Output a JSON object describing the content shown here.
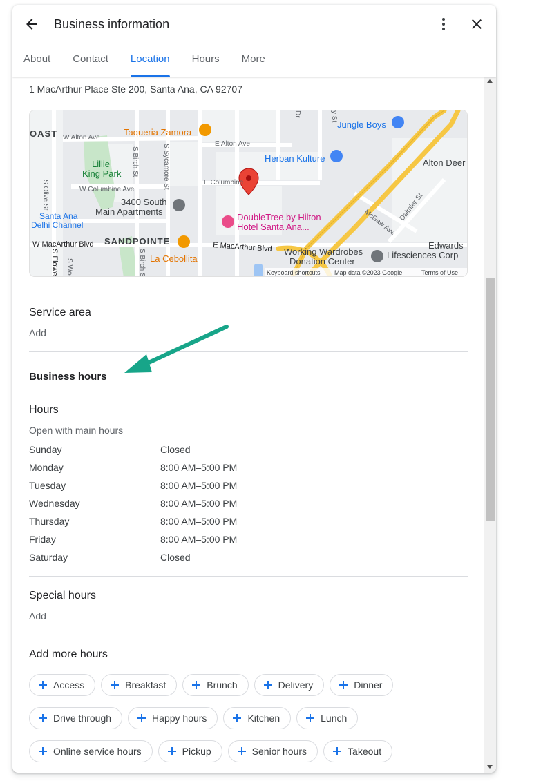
{
  "header": {
    "title": "Business information",
    "tabs": [
      {
        "label": "About",
        "active": false
      },
      {
        "label": "Contact",
        "active": false
      },
      {
        "label": "Location",
        "active": true
      },
      {
        "label": "Hours",
        "active": false
      },
      {
        "label": "More",
        "active": false
      }
    ]
  },
  "location": {
    "address": "1 MacArthur Place Ste 200, Santa Ana, CA 92707",
    "map": {
      "labels": {
        "taqueria": "Taqueria Zamora",
        "jungle": "Jungle Boys",
        "herban": "Herban Kulture",
        "alton_deer": "Alton Deer",
        "lillie1": "Lillie",
        "lillie2": "King Park",
        "apt1": "3400 South",
        "apt2": "Main Apartments",
        "santa_ana1": "Santa Ana",
        "santa_ana2": "Delhi Channel",
        "doubletree1": "DoubleTree by Hilton",
        "doubletree2": "Hotel Santa Ana...",
        "sandpointe": "SANDPOINTE",
        "cebollita": "La Cebollita",
        "working1": "Working Wardrobes",
        "working2": "Donation Center",
        "edwards1": "Edwards",
        "edwards2": "Lifesciences Corp",
        "coast": "OAST",
        "w_alton": "W Alton Ave",
        "e_alton": "E Alton Ave",
        "e_columbine": "E Columbine",
        "w_columbine": "W Columbine Ave",
        "w_macarthur": "W MacArthur Blvd",
        "e_macarthur": "E MacArthur Blvd",
        "s_birch": "S Birch St",
        "s_sycamore": "S Sycamore St",
        "s_olive": "S Olive St",
        "s_birch2": "S Birch St",
        "s_flower": "S Flower",
        "s_wood": "S Wood",
        "mcgaw": "McGaw Ave",
        "daimler": "Daimler St",
        "dr": "Dr",
        "y_st": "y St"
      },
      "footer": {
        "shortcuts": "Keyboard shortcuts",
        "data": "Map data ©2023 Google",
        "terms": "Terms of Use"
      }
    }
  },
  "service_area": {
    "title": "Service area",
    "action": "Add"
  },
  "business_hours": {
    "title": "Business hours",
    "hours_title": "Hours",
    "hours_sub": "Open with main hours",
    "days": [
      {
        "day": "Sunday",
        "time": "Closed"
      },
      {
        "day": "Monday",
        "time": "8:00 AM–5:00 PM"
      },
      {
        "day": "Tuesday",
        "time": "8:00 AM–5:00 PM"
      },
      {
        "day": "Wednesday",
        "time": "8:00 AM–5:00 PM"
      },
      {
        "day": "Thursday",
        "time": "8:00 AM–5:00 PM"
      },
      {
        "day": "Friday",
        "time": "8:00 AM–5:00 PM"
      },
      {
        "day": "Saturday",
        "time": "Closed"
      }
    ]
  },
  "special_hours": {
    "title": "Special hours",
    "action": "Add"
  },
  "add_more_hours": {
    "title": "Add more hours",
    "chips": [
      [
        "Access",
        "Breakfast",
        "Brunch",
        "Delivery",
        "Dinner"
      ],
      [
        "Drive through",
        "Happy hours",
        "Kitchen",
        "Lunch"
      ],
      [
        "Online service hours",
        "Pickup",
        "Senior hours",
        "Takeout"
      ]
    ]
  },
  "colors": {
    "accent": "#1a73e8",
    "annotation_arrow": "#17a589",
    "map_pin": "#ea4335",
    "highway": "#f6c744"
  },
  "icons": {
    "back": "arrow-back-icon",
    "more": "more-vert-icon",
    "close": "close-icon",
    "pin": "map-pin-icon",
    "chip_plus": "plus-icon"
  }
}
